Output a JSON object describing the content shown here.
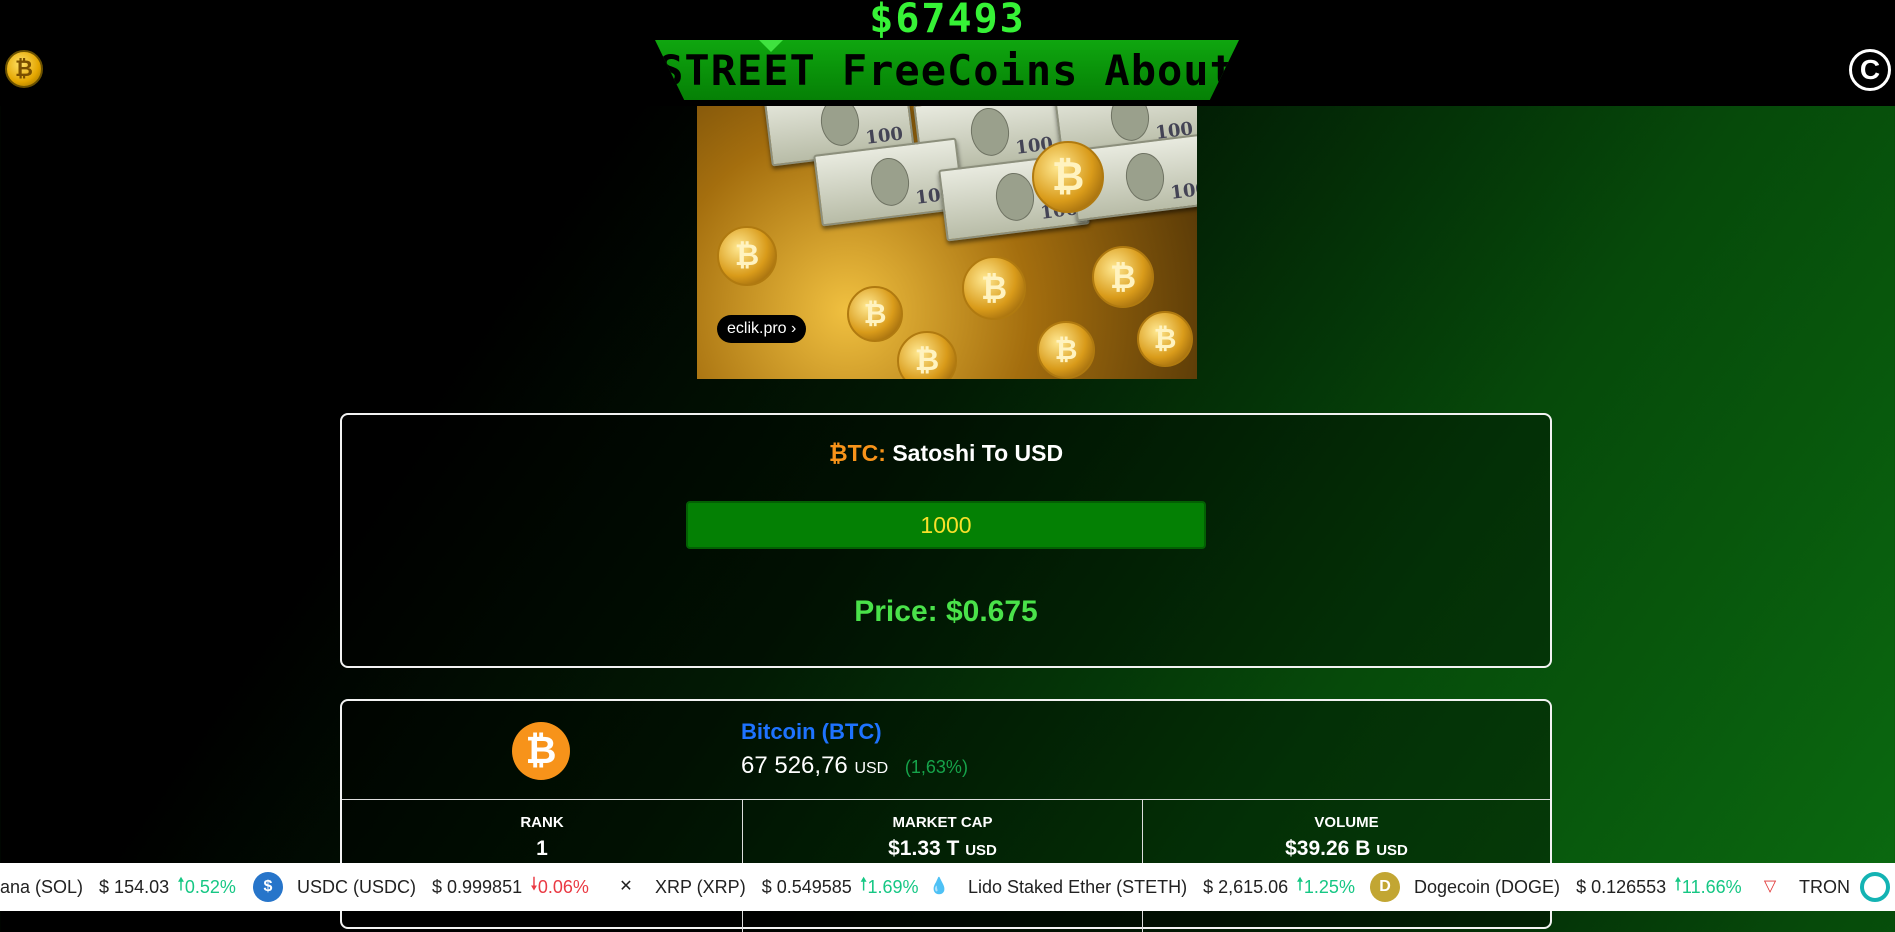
{
  "header": {
    "btc_price": "$67493",
    "nav": [
      "STREET",
      "FreeCoins",
      "About"
    ],
    "left_logo_icon": "bitcoin-coin-icon",
    "left_logo_glyph": "₿",
    "right_logo_icon": "copyright-icon",
    "right_logo_glyph": "C"
  },
  "ad": {
    "button_label": "eclik.pro ›",
    "coin_glyph": "₿"
  },
  "converter": {
    "title_prefix": "₿TC:",
    "title_text": "Satoshi To USD",
    "input_value": "1000",
    "price_text": "Price: $0.675"
  },
  "coin_card": {
    "logo_glyph": "₿",
    "name": "Bitcoin (BTC)",
    "price": "67 526,76",
    "price_unit": "USD",
    "change": "(1,63%)",
    "stats": [
      {
        "label": "RANK",
        "value": "1",
        "unit": ""
      },
      {
        "label": "MARKET CAP",
        "value": "$1.33 T",
        "unit": "USD"
      },
      {
        "label": "VOLUME",
        "value": "$39.26 B",
        "unit": "USD"
      }
    ]
  },
  "ticker": [
    {
      "name": "ana (SOL)",
      "price": "$ 154.03",
      "change": "0.52%",
      "dir": "up",
      "arrow": "🠕",
      "icon": "",
      "color": ""
    },
    {
      "name": "USDC (USDC)",
      "price": "$ 0.999851",
      "change": "0.06%",
      "dir": "down",
      "arrow": "🠗",
      "icon": "$",
      "color": "#2775ca"
    },
    {
      "name": "XRP (XRP)",
      "price": "$ 0.549585",
      "change": "1.69%",
      "dir": "up",
      "arrow": "🠕",
      "icon": "✕",
      "color": "#ffffff"
    },
    {
      "name": "Lido Staked Ether (STETH)",
      "price": "$ 2,615.06",
      "change": "1.25%",
      "dir": "up",
      "arrow": "🠕",
      "icon": "💧",
      "color": "#ffffff"
    },
    {
      "name": "Dogecoin (DOGE)",
      "price": "$ 0.126553",
      "change": "11.66%",
      "dir": "up",
      "arrow": "🠕",
      "icon": "D",
      "color": "#c2a633"
    },
    {
      "name": "TRON",
      "price": "",
      "change": "",
      "dir": "up",
      "arrow": "",
      "icon": "▽",
      "color": "#ffffff"
    }
  ]
}
